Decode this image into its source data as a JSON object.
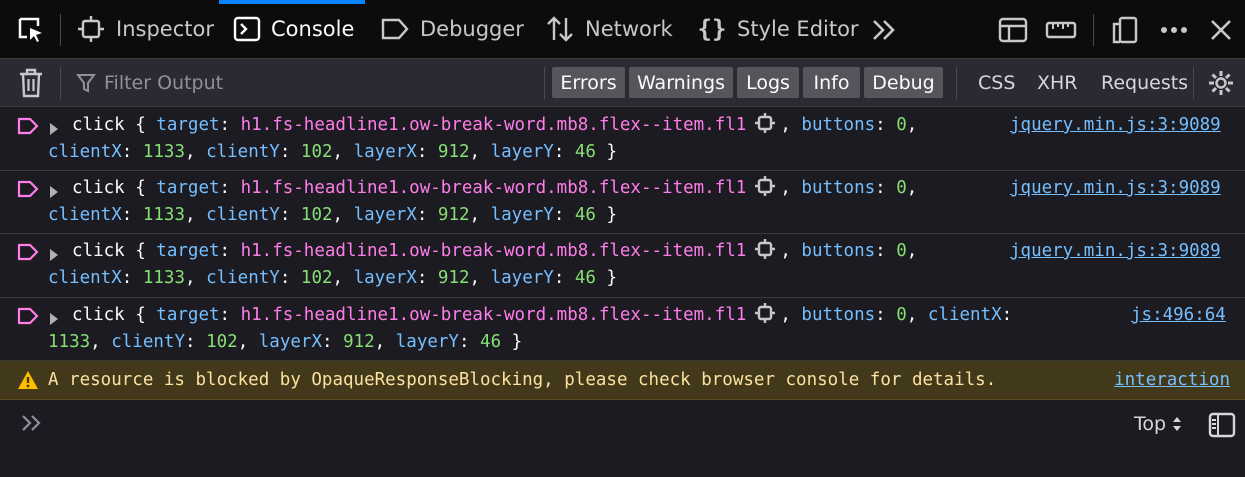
{
  "tabs": [
    {
      "label": "Inspector",
      "icon": "inspector-icon"
    },
    {
      "label": "Console",
      "icon": "console-icon",
      "selected": true
    },
    {
      "label": "Debugger",
      "icon": "debugger-icon"
    },
    {
      "label": "Network",
      "icon": "network-icon"
    },
    {
      "label": "Style Editor",
      "icon": "style-editor-icon"
    }
  ],
  "toolbar": {
    "filter_placeholder": "Filter Output",
    "levels": [
      "Errors",
      "Warnings",
      "Logs",
      "Info",
      "Debug"
    ],
    "requests": [
      "CSS",
      "XHR",
      "Requests"
    ]
  },
  "messages": [
    {
      "event": "click",
      "target_key": "target",
      "selector": "h1.fs-headline1.ow-break-word.mb8.flex--item.fl1",
      "line1_rest": [
        {
          "k": "buttons",
          "v": "0"
        }
      ],
      "line2": [
        {
          "k": "clientX",
          "v": "1133"
        },
        {
          "k": "clientY",
          "v": "102"
        },
        {
          "k": "layerX",
          "v": "912"
        },
        {
          "k": "layerY",
          "v": "46"
        }
      ],
      "source": "jquery.min.js:3:9089"
    },
    {
      "event": "click",
      "target_key": "target",
      "selector": "h1.fs-headline1.ow-break-word.mb8.flex--item.fl1",
      "line1_rest": [
        {
          "k": "buttons",
          "v": "0"
        }
      ],
      "line2": [
        {
          "k": "clientX",
          "v": "1133"
        },
        {
          "k": "clientY",
          "v": "102"
        },
        {
          "k": "layerX",
          "v": "912"
        },
        {
          "k": "layerY",
          "v": "46"
        }
      ],
      "source": "jquery.min.js:3:9089"
    },
    {
      "event": "click",
      "target_key": "target",
      "selector": "h1.fs-headline1.ow-break-word.mb8.flex--item.fl1",
      "line1_rest": [
        {
          "k": "buttons",
          "v": "0"
        }
      ],
      "line2": [
        {
          "k": "clientX",
          "v": "1133"
        },
        {
          "k": "clientY",
          "v": "102"
        },
        {
          "k": "layerX",
          "v": "912"
        },
        {
          "k": "layerY",
          "v": "46"
        }
      ],
      "source": "jquery.min.js:3:9089"
    },
    {
      "event": "click",
      "target_key": "target",
      "selector": "h1.fs-headline1.ow-break-word.mb8.flex--item.fl1",
      "line1_rest": [
        {
          "k": "buttons",
          "v": "0"
        },
        {
          "k": "clientX",
          "v": ""
        }
      ],
      "line2_lead": "1133",
      "line2": [
        {
          "k": "clientY",
          "v": "102"
        },
        {
          "k": "layerX",
          "v": "912"
        },
        {
          "k": "layerY",
          "v": "46"
        }
      ],
      "source": "js:496:64"
    }
  ],
  "warning": {
    "text": "A resource is blocked by OpaqueResponseBlocking, please check browser console for details.",
    "source": "interaction"
  },
  "input": {
    "context": "Top"
  },
  "colors": {
    "accent": "#0a84ff",
    "key": "#75bfff",
    "selector": "#ff7de9",
    "number": "#86de74",
    "warning_bg": "#42381a",
    "warning_text": "#fce19f"
  }
}
